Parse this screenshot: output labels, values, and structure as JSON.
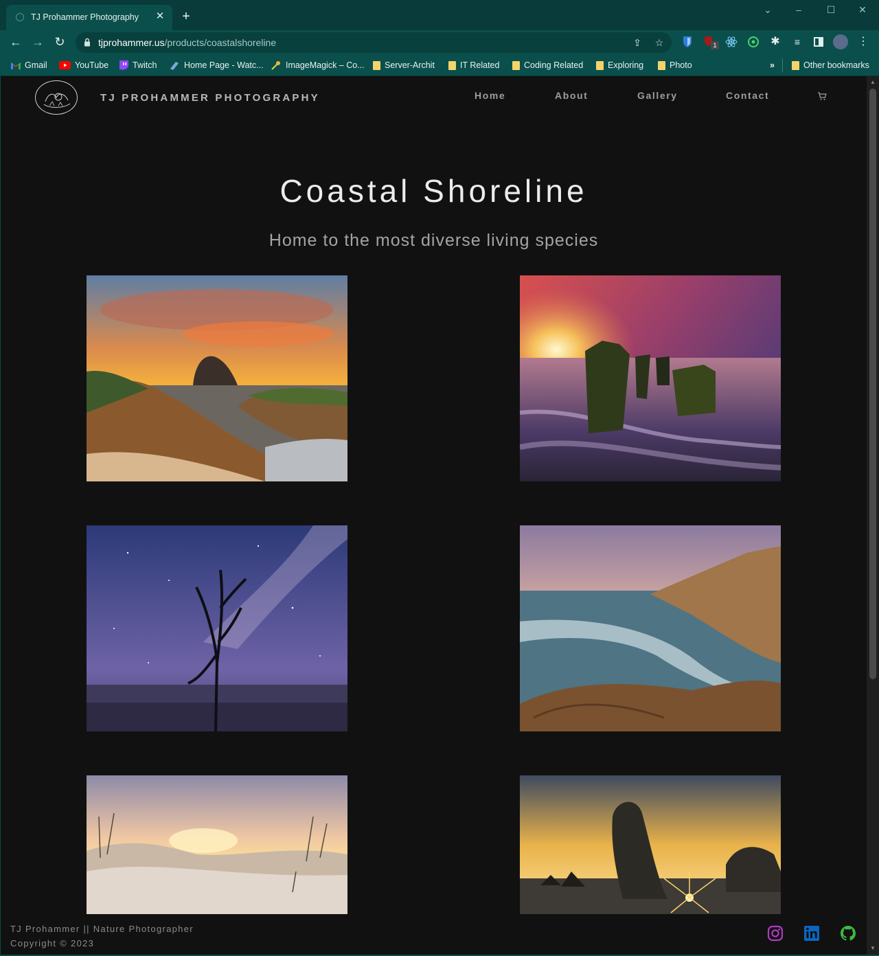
{
  "browser": {
    "tab_title": "TJ Prohammer Photography",
    "url_host": "tjprohammer.us",
    "url_path": "/products/coastalshoreline",
    "extension_badge": "1",
    "bookmarks": [
      {
        "label": "Gmail",
        "icon": "gmail-icon"
      },
      {
        "label": "YouTube",
        "icon": "youtube-icon"
      },
      {
        "label": "Twitch",
        "icon": "twitch-icon"
      },
      {
        "label": "Home Page - Watc...",
        "icon": "bookmark-site-icon"
      },
      {
        "label": "ImageMagick – Co...",
        "icon": "imagemagick-icon"
      },
      {
        "label": "Server-Archit",
        "icon": "folder-icon"
      },
      {
        "label": "IT Related",
        "icon": "folder-icon"
      },
      {
        "label": "Coding Related",
        "icon": "folder-icon"
      },
      {
        "label": "Exploring",
        "icon": "folder-icon"
      },
      {
        "label": "Photo",
        "icon": "folder-icon"
      }
    ],
    "overflow_label": "»",
    "other_bookmarks": "Other bookmarks"
  },
  "site": {
    "brand": "TJ PROHAMMER PHOTOGRAPHY",
    "nav": [
      "Home",
      "About",
      "Gallery",
      "Contact"
    ],
    "cart_icon": "cart-icon"
  },
  "hero": {
    "title": "Coastal Shoreline",
    "subtitle": "Home to the most diverse living species"
  },
  "gallery": [
    "haystack-rock-sunset-photo",
    "pier-pilings-sunset-photo",
    "milky-way-dead-tree-photo",
    "cape-kiwanda-waves-photo",
    "sand-dunes-sunrise-photo",
    "sea-stack-sunburst-photo"
  ],
  "footer": {
    "line1": "TJ Prohammer || Nature Photographer",
    "line2": "Copyright © 2023",
    "social": [
      "instagram-icon",
      "linkedin-icon",
      "github-icon"
    ]
  },
  "colors": {
    "browser_frame": "#0a4f4b",
    "page_bg": "#111111",
    "instagram": "#b13ac4",
    "linkedin": "#0a66c2",
    "github": "#3fb93f"
  }
}
